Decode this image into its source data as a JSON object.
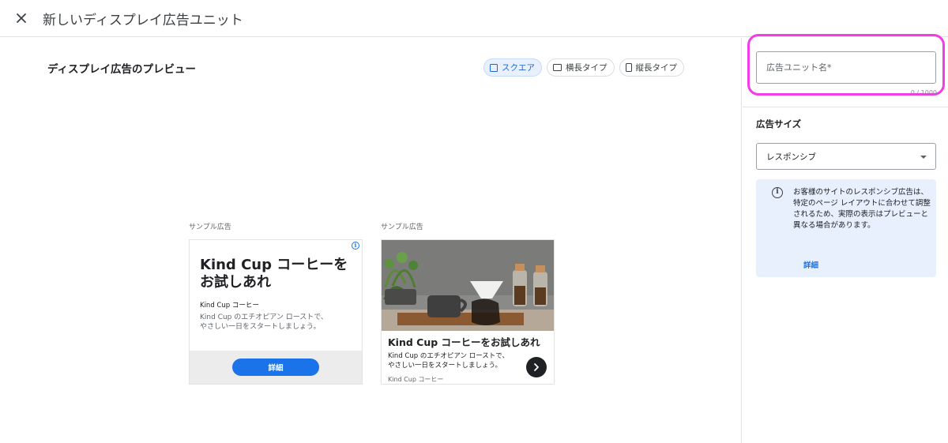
{
  "header": {
    "title": "新しいディスプレイ広告ユニット"
  },
  "preview": {
    "title": "ディスプレイ広告のプレビュー",
    "chips": [
      {
        "label": "スクエア",
        "icon": "square-icon",
        "selected": true
      },
      {
        "label": "横長タイプ",
        "icon": "landscape-icon",
        "selected": false
      },
      {
        "label": "縦長タイプ",
        "icon": "portrait-icon",
        "selected": false
      }
    ]
  },
  "ads": [
    {
      "label": "サンプル広告",
      "headline_line1": "Kind Cup コーヒーを",
      "headline_line2": "お試しあれ",
      "brand": "Kind Cup コーヒー",
      "desc_line1": "Kind Cup のエチオピアン ローストで、",
      "desc_line2": "やさしい一日をスタートしましょう。",
      "button": "詳細"
    },
    {
      "label": "サンプル広告",
      "headline": "Kind Cup コーヒーをお試しあれ",
      "desc_line1": "Kind Cup のエチオピアン ローストで、",
      "desc_line2": "やさしい一日をスタートしましょう。",
      "brand": "Kind Cup コーヒー"
    }
  ],
  "sidebar": {
    "name_placeholder": "広告ユニット名*",
    "char_count": "0 / 1000",
    "size_title": "広告サイズ",
    "size_value": "レスポンシブ",
    "info_text": "お客様のサイトのレスポンシブ広告は、特定のページ レイアウトに合わせて調整されるため、実際の表示はプレビューと異なる場合があります。",
    "info_link": "詳細"
  },
  "colors": {
    "accent": "#1a73e8",
    "highlight": "#f23ce8",
    "info_bg": "#e8f0fe"
  }
}
